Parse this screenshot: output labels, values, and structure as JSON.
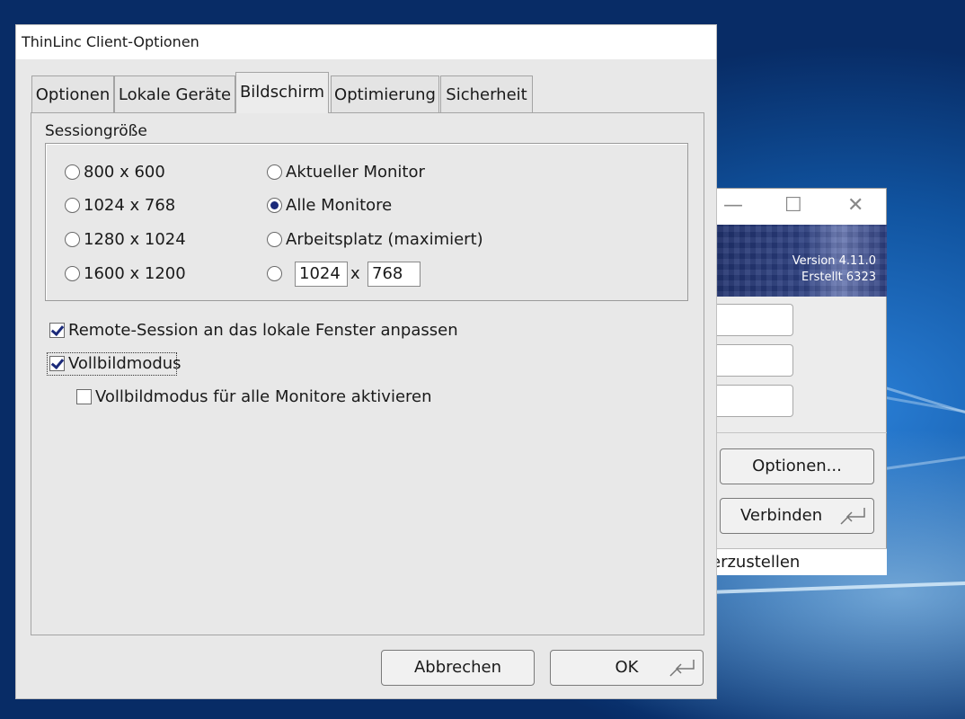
{
  "dialog": {
    "title": "ThinLinc Client-Optionen",
    "tabs": [
      {
        "label": "Optionen",
        "active": false
      },
      {
        "label": "Lokale Geräte",
        "active": false
      },
      {
        "label": "Bildschirm",
        "active": true
      },
      {
        "label": "Optimierung",
        "active": false
      },
      {
        "label": "Sicherheit",
        "active": false
      }
    ],
    "session_size": {
      "label": "Sessiongröße",
      "options": [
        {
          "label": "800 x 600",
          "selected": false
        },
        {
          "label": "1024 x 768",
          "selected": false
        },
        {
          "label": "1280 x 1024",
          "selected": false
        },
        {
          "label": "1600 x 1200",
          "selected": false
        },
        {
          "label": "Aktueller Monitor",
          "selected": false
        },
        {
          "label": "Alle Monitore",
          "selected": true
        },
        {
          "label": "Arbeitsplatz (maximiert)",
          "selected": false
        }
      ],
      "custom": {
        "width": "1024",
        "separator": "x",
        "height": "768",
        "selected": false
      }
    },
    "checkboxes": [
      {
        "label": "Remote-Session an das lokale Fenster anpassen",
        "checked": true
      },
      {
        "label": "Vollbildmodus",
        "checked": true
      },
      {
        "label": "Vollbildmodus für alle Monitore aktivieren",
        "checked": false
      }
    ],
    "buttons": {
      "cancel": "Abbrechen",
      "ok": "OK"
    }
  },
  "client_window": {
    "title_controls": {
      "minimize": "—",
      "maximize": "☐",
      "close": "✕"
    },
    "version": "Version 4.11.0",
    "build": "Erstellt 6323",
    "options_button": "Optionen...",
    "connect_button": "Verbinden",
    "status_text": "erzustellen"
  }
}
